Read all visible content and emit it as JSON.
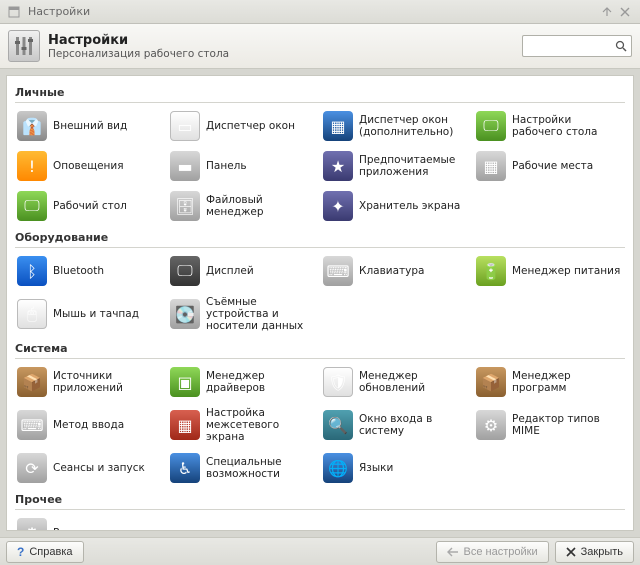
{
  "window": {
    "title": "Настройки"
  },
  "header": {
    "title": "Настройки",
    "subtitle": "Персонализация рабочего стола",
    "search_placeholder": ""
  },
  "sections": [
    {
      "title": "Личные",
      "items": [
        {
          "id": "appearance",
          "label": "Внешний вид",
          "icon": "suit-icon",
          "bg": "bg-suit",
          "glyph": "👔"
        },
        {
          "id": "wm",
          "label": "Диспетчер окон",
          "icon": "windows-icon",
          "bg": "bg-white",
          "glyph": "▭"
        },
        {
          "id": "wm-tweaks",
          "label": "Диспетчер окон (дополнительно)",
          "icon": "windows-adv-icon",
          "bg": "bg-blue",
          "glyph": "▦"
        },
        {
          "id": "desktop-settings",
          "label": "Настройки рабочего стола",
          "icon": "desktop-settings-icon",
          "bg": "bg-green",
          "glyph": "🖵"
        },
        {
          "id": "notifications",
          "label": "Оповещения",
          "icon": "notification-icon",
          "bg": "bg-orange",
          "glyph": "!"
        },
        {
          "id": "panel",
          "label": "Панель",
          "icon": "panel-icon",
          "bg": "bg-gray",
          "glyph": "▬"
        },
        {
          "id": "preferred-apps",
          "label": "Предпочитаемые приложения",
          "icon": "star-icon",
          "bg": "bg-purple",
          "glyph": "★"
        },
        {
          "id": "workspaces",
          "label": "Рабочие места",
          "icon": "workspaces-icon",
          "bg": "bg-gray",
          "glyph": "▦"
        },
        {
          "id": "desktop",
          "label": "Рабочий стол",
          "icon": "desktop-icon",
          "bg": "bg-green",
          "glyph": "🖵"
        },
        {
          "id": "file-manager",
          "label": "Файловый менеджер",
          "icon": "file-manager-icon",
          "bg": "bg-gray",
          "glyph": "🗄"
        },
        {
          "id": "screensaver",
          "label": "Хранитель экрана",
          "icon": "screensaver-icon",
          "bg": "bg-purple",
          "glyph": "✦"
        }
      ]
    },
    {
      "title": "Оборудование",
      "items": [
        {
          "id": "bluetooth",
          "label": "Bluetooth",
          "icon": "bluetooth-icon",
          "bg": "bg-bt",
          "glyph": "ᛒ"
        },
        {
          "id": "display",
          "label": "Дисплей",
          "icon": "display-icon",
          "bg": "bg-dark",
          "glyph": "🖵"
        },
        {
          "id": "keyboard",
          "label": "Клавиатура",
          "icon": "keyboard-icon",
          "bg": "bg-gray",
          "glyph": "⌨"
        },
        {
          "id": "power",
          "label": "Менеджер питания",
          "icon": "power-icon",
          "bg": "bg-lime",
          "glyph": "🔋"
        },
        {
          "id": "mouse",
          "label": "Мышь и тачпад",
          "icon": "mouse-icon",
          "bg": "bg-white",
          "glyph": "🖱"
        },
        {
          "id": "removable",
          "label": "Съёмные устройства и носители данных",
          "icon": "drive-icon",
          "bg": "bg-gray",
          "glyph": "💽"
        }
      ]
    },
    {
      "title": "Система",
      "items": [
        {
          "id": "software-sources",
          "label": "Источники приложений",
          "icon": "box-icon",
          "bg": "bg-brown",
          "glyph": "📦"
        },
        {
          "id": "driver-manager",
          "label": "Менеджер драйверов",
          "icon": "chip-icon",
          "bg": "bg-green",
          "glyph": "▣"
        },
        {
          "id": "update-manager",
          "label": "Менеджер обновлений",
          "icon": "shield-icon",
          "bg": "bg-white",
          "glyph": "🛡"
        },
        {
          "id": "software-manager",
          "label": "Менеджер программ",
          "icon": "package-icon",
          "bg": "bg-brown",
          "glyph": "📦"
        },
        {
          "id": "input-method",
          "label": "Метод ввода",
          "icon": "input-icon",
          "bg": "bg-gray",
          "glyph": "⌨"
        },
        {
          "id": "firewall",
          "label": "Настройка межсетевого экрана",
          "icon": "firewall-icon",
          "bg": "bg-red",
          "glyph": "▦"
        },
        {
          "id": "login-window",
          "label": "Окно входа в систему",
          "icon": "login-icon",
          "bg": "bg-teal",
          "glyph": "🔍"
        },
        {
          "id": "mime",
          "label": "Редактор типов MIME",
          "icon": "mime-icon",
          "bg": "bg-gray",
          "glyph": "⚙"
        },
        {
          "id": "sessions",
          "label": "Сеансы и запуск",
          "icon": "session-icon",
          "bg": "bg-gray",
          "glyph": "⟳"
        },
        {
          "id": "accessibility",
          "label": "Специальные возможности",
          "icon": "accessibility-icon",
          "bg": "bg-blue",
          "glyph": "♿"
        },
        {
          "id": "languages",
          "label": "Языки",
          "icon": "languages-icon",
          "bg": "bg-blue",
          "glyph": "🌐"
        }
      ]
    },
    {
      "title": "Прочее",
      "items": [
        {
          "id": "settings-editor",
          "label": "Редактор настроек",
          "icon": "gear-grid-icon",
          "bg": "bg-gray",
          "glyph": "⚙"
        }
      ]
    }
  ],
  "footer": {
    "help": "Справка",
    "all_settings": "Все настройки",
    "close": "Закрыть"
  }
}
